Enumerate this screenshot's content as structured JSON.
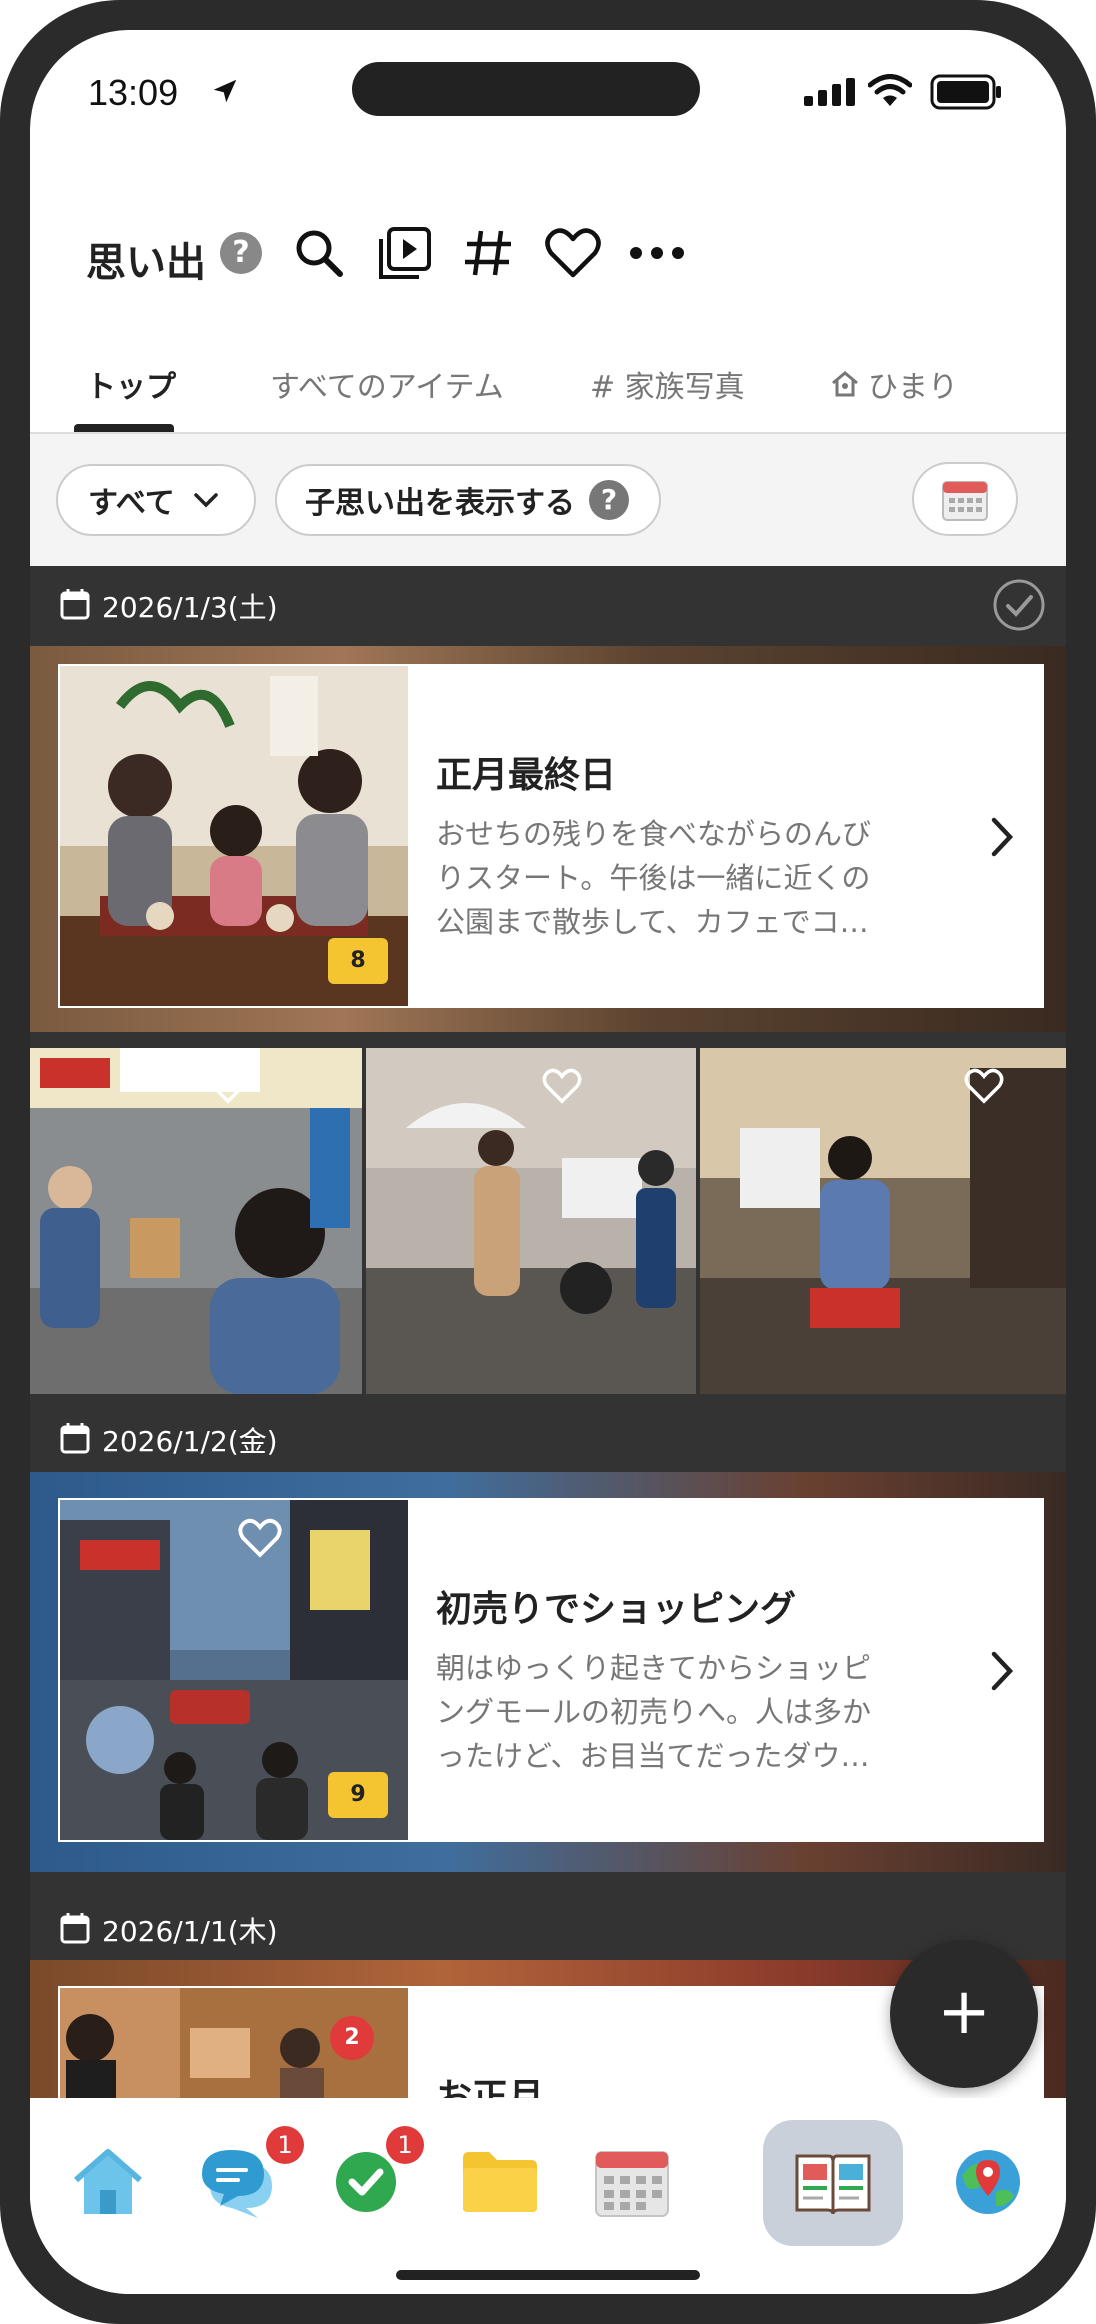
{
  "status_bar": {
    "time": "13:09"
  },
  "header": {
    "title": "思い出",
    "help": "?",
    "icons": [
      "search-icon",
      "slideshow-icon",
      "hashtag-icon",
      "heart-icon",
      "more-icon"
    ]
  },
  "tabs": [
    {
      "label": "トップ",
      "active": true
    },
    {
      "label": "すべてのアイテム",
      "active": false
    },
    {
      "label": "# 家族写真",
      "active": false
    },
    {
      "label": "ひまり",
      "active": false
    }
  ],
  "filters": {
    "all_label": "すべて",
    "child_label": "子思い出を表示する",
    "child_help": "?"
  },
  "feed": [
    {
      "date": "2026/1/3(土)",
      "title": "正月最終日",
      "description": "おせちの残りを食べながらのんびりスタート。午後は一緒に近くの公園まで散歩して、カフェでコ…",
      "count": "8"
    },
    {
      "date": "2026/1/2(金)",
      "title": "初売りでショッピング",
      "description": "朝はゆっくり起きてからショッピングモールの初売りへ。人は多かったけど、お目当てだったダウ…",
      "count": "9"
    },
    {
      "date": "2026/1/1(木)",
      "title": "お正月",
      "description": "",
      "count": "2"
    }
  ],
  "bottom_nav": {
    "items": [
      {
        "name": "home-icon",
        "badge": ""
      },
      {
        "name": "chat-icon",
        "badge": "1"
      },
      {
        "name": "tasks-icon",
        "badge": "1"
      },
      {
        "name": "folder-icon",
        "badge": ""
      },
      {
        "name": "calendar-icon",
        "badge": ""
      },
      {
        "name": "memories-icon",
        "badge": ""
      },
      {
        "name": "map-icon",
        "badge": ""
      }
    ],
    "active_index": 5
  },
  "fab": {
    "label": "+"
  },
  "colors": {
    "accent_badge": "#f5c531",
    "notification": "#e03a3a",
    "feed_bg": "#333333"
  }
}
